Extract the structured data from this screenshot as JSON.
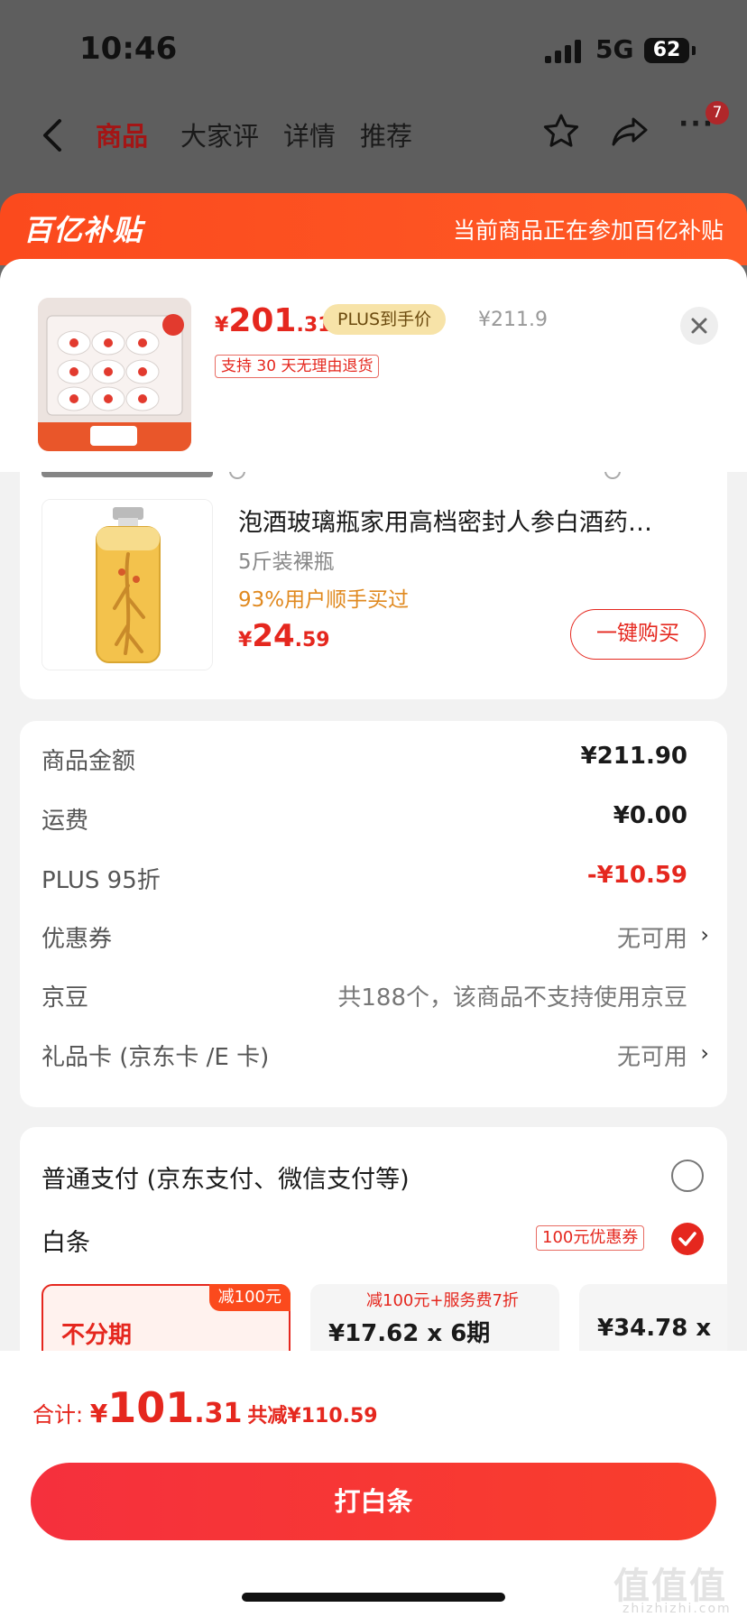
{
  "status_bar": {
    "time": "10:46",
    "network": "5G",
    "battery": "62"
  },
  "nav": {
    "tabs": [
      "商品",
      "大家评",
      "详情",
      "推荐"
    ],
    "more": "···",
    "badge": "7"
  },
  "subsidy": {
    "logo": "百亿补贴",
    "text": "当前商品正在参加百亿补贴"
  },
  "product": {
    "currency": "¥",
    "price_int": "201",
    "price_dec": ".31",
    "plus_tag": "PLUS到手价",
    "original_price": "¥211.9",
    "return_policy": "支持 30 天无理由退货"
  },
  "recommend": {
    "title": "泡酒玻璃瓶家用高档密封人参白酒药…",
    "spec": "5斤装裸瓶",
    "bought": "93%用户顺手买过",
    "currency": "¥",
    "price_int": "24",
    "price_dec": ".59",
    "buy_label": "一键购买"
  },
  "cost": {
    "rows": [
      {
        "label": "商品金额",
        "value": "¥211.90"
      },
      {
        "label": "运费",
        "value": "¥0.00"
      },
      {
        "label": "PLUS 95折",
        "value": "-¥10.59"
      },
      {
        "label": "优惠券",
        "value": "无可用",
        "chevron": "›"
      },
      {
        "label": "京豆",
        "value": "共188个，该商品不支持使用京豆"
      },
      {
        "label": "礼品卡 (京东卡 /E 卡)",
        "value": "无可用",
        "chevron": "›"
      }
    ]
  },
  "payment": {
    "normal_label": "普通支付 (京东支付、微信支付等)",
    "baitiao_label": "白条",
    "coupon_tag": "100元优惠券",
    "plans": [
      {
        "label": "不分期",
        "badge": "减100元",
        "selected": true
      },
      {
        "label": "¥17.62 x 6期",
        "note": "减100元+服务费7折"
      },
      {
        "label": "¥34.78 x"
      }
    ]
  },
  "total": {
    "label": "合计: ",
    "currency": "¥",
    "int": "101",
    "dec": ".31",
    "saved": "共减¥110.59"
  },
  "pay_button": "打白条",
  "watermark": {
    "text": "值值值",
    "url": "zhizhizhi.com"
  },
  "colors": {
    "accent": "#e5271e",
    "subsidy": "#fb4a1d",
    "plus_gold": "#f7e3a8"
  }
}
